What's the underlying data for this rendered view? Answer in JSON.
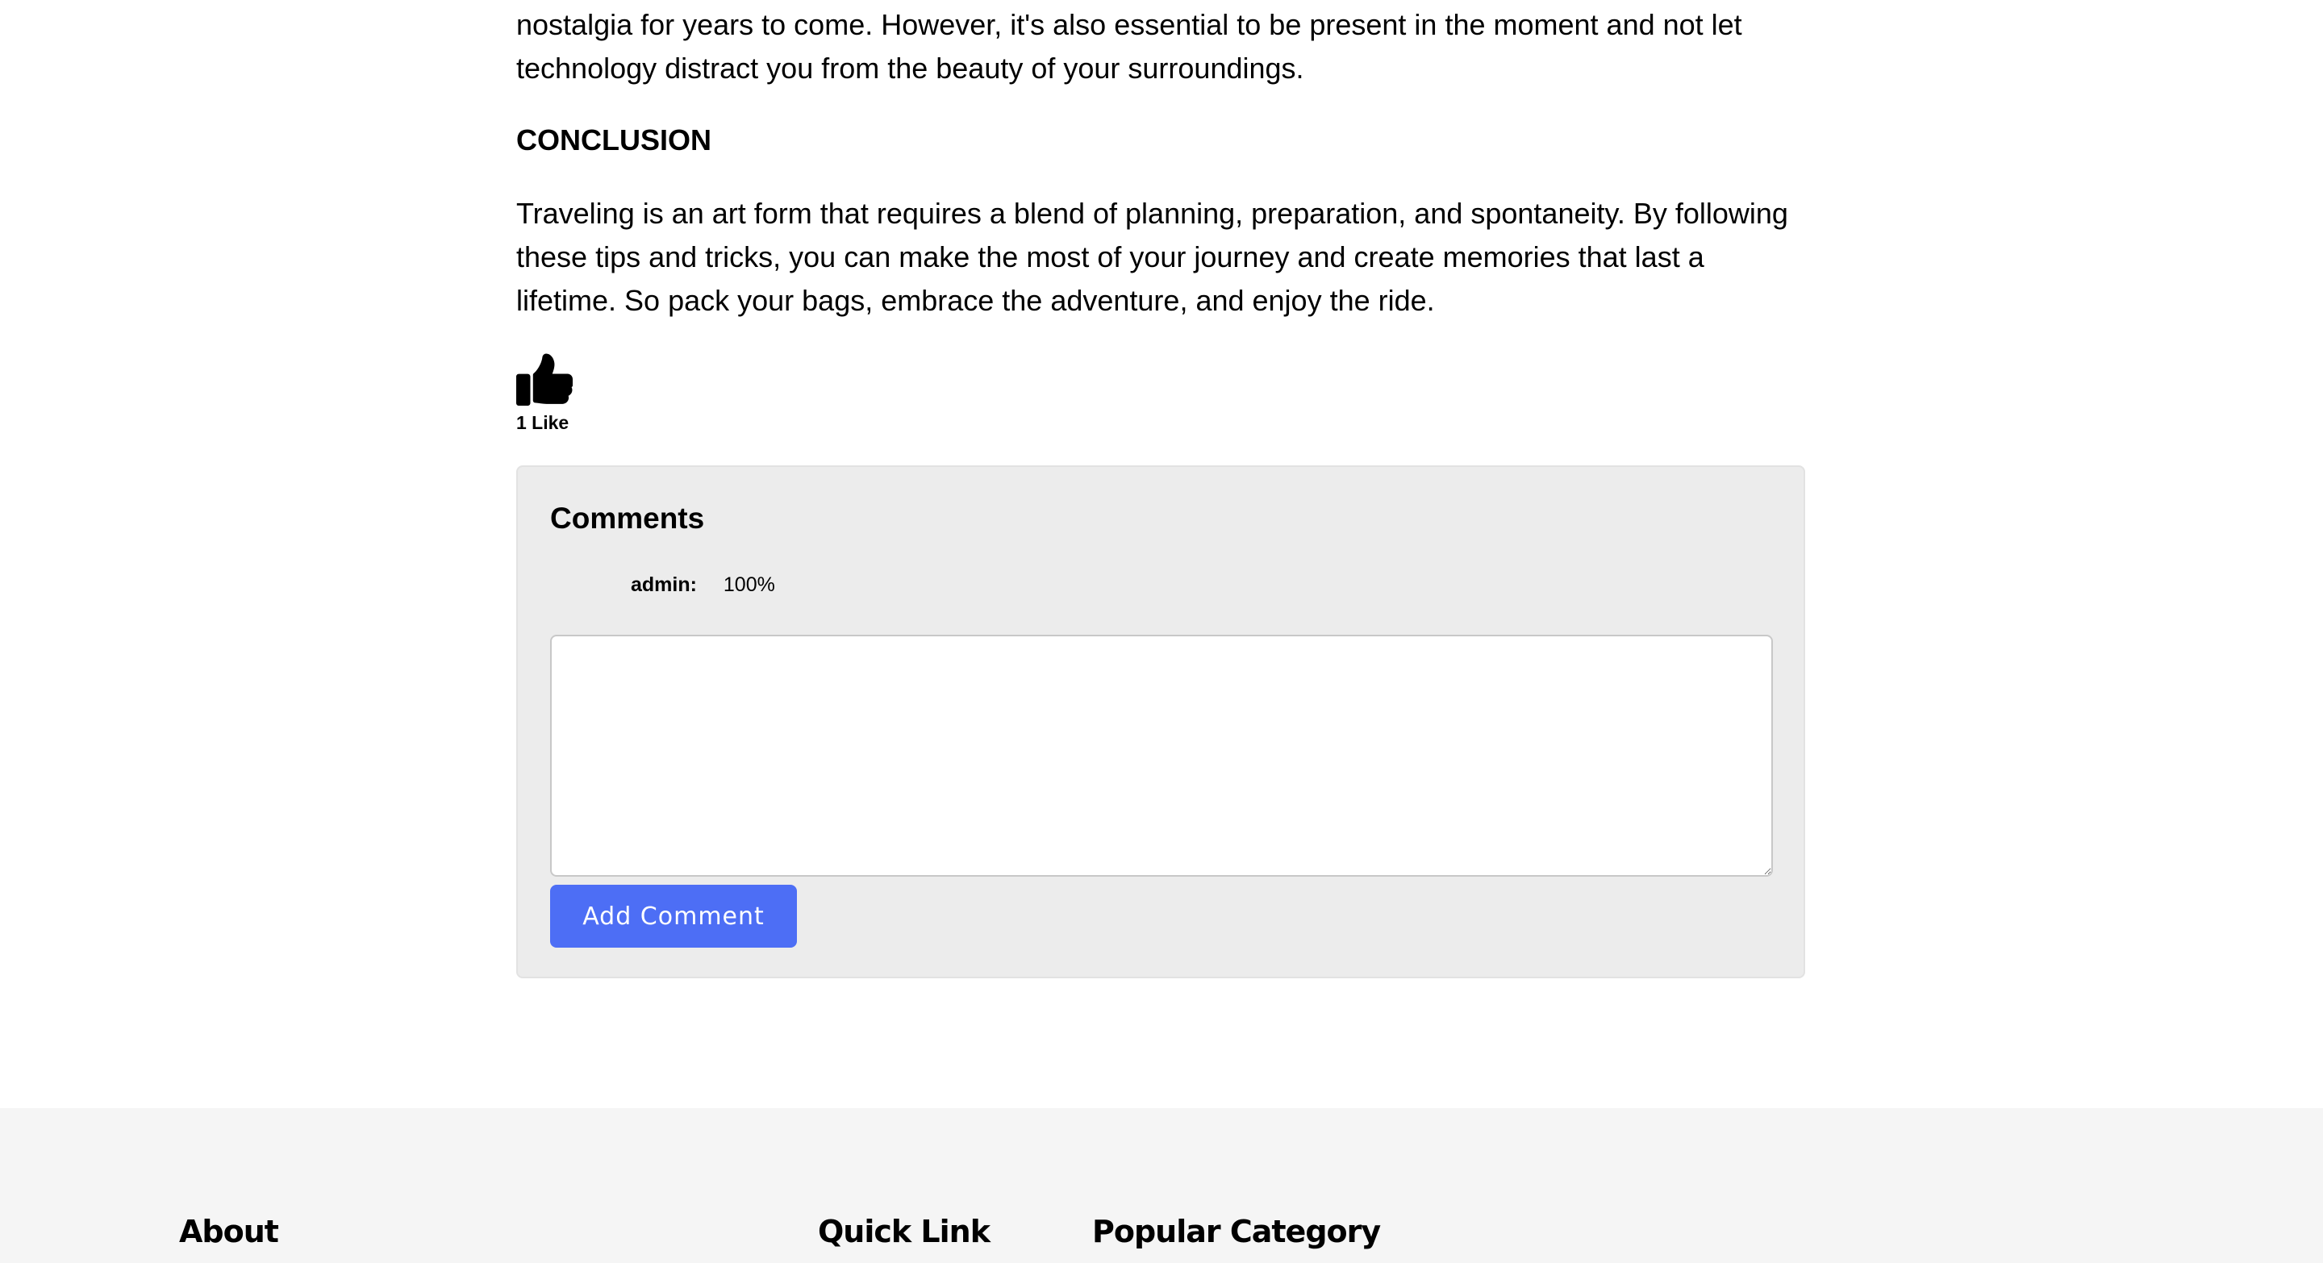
{
  "article": {
    "intro_paragraph_tail": "nostalgia for years to come. However, it's also essential to be present in the moment and not let technology distract you from the beauty of your surroundings.",
    "conclusion_heading": "CONCLUSION",
    "conclusion_paragraph": "Traveling is an art form that requires a blend of planning, preparation, and spontaneity. By following these tips and tricks, you can make the most of your journey and create memories that last a lifetime. So pack your bags, embrace the adventure, and enjoy the ride."
  },
  "likes": {
    "icon": "thumbs-up-icon",
    "label": "1 Like"
  },
  "comments": {
    "title": "Comments",
    "items": [
      {
        "author": "admin:",
        "text": "100%"
      }
    ],
    "input_value": "",
    "submit_label": "Add Comment",
    "submit_color": "#4d6ef5"
  },
  "footer": {
    "about_heading": "About",
    "quick_link_heading": "Quick Link",
    "popular_category_heading": "Popular Category"
  }
}
